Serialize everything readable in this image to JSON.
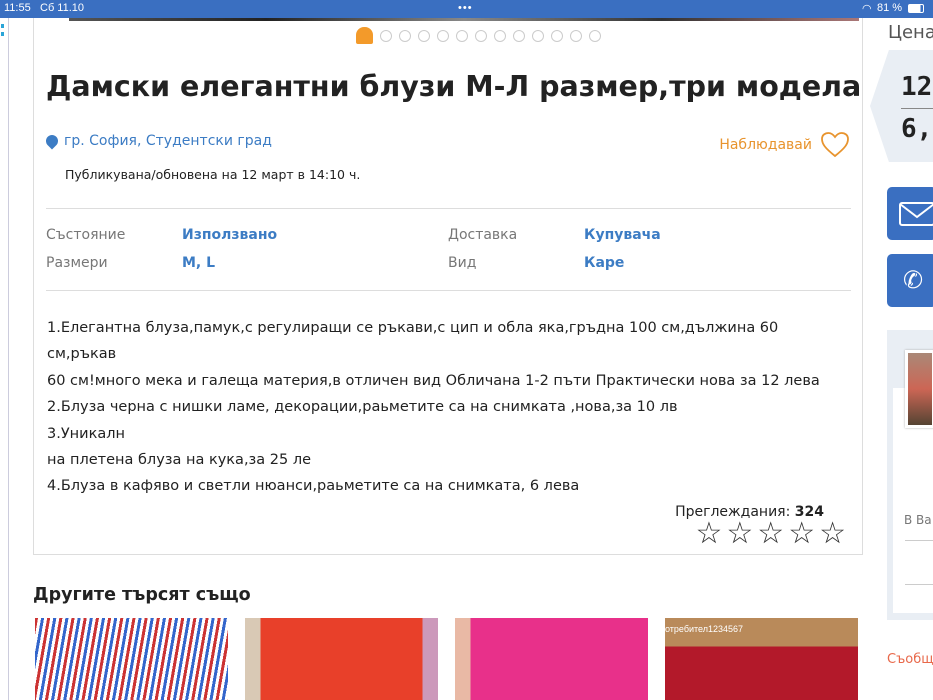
{
  "status": {
    "time": "11:55",
    "date": "Сб 11.10",
    "battery": "81 %"
  },
  "title": "Дамски елегантни блузи М-Л размер,три модела",
  "location": "гр. София, Студентски град",
  "watch_label": "Наблюдавай",
  "published": "Публикувана/обновена на 12 март в 14:10 ч.",
  "details": [
    {
      "label": "Състояние",
      "value": "Използвано"
    },
    {
      "label": "Доставка",
      "value": "Купувача"
    },
    {
      "label": "Размери",
      "value": "M, L"
    },
    {
      "label": "Вид",
      "value": "Каре"
    }
  ],
  "description": [
    "1.Елегантна блуза,памук,с регулиращи се ръкави,с цип и обла яка,гръдна 100 см,дължина 60 см,ръкав",
    "60 см!много мека и галеща материя,в отличен вид Обличана 1-2 пъти Практически нова за 12 лева",
    "2.Блуза черна с нишки ламе, декорации,раьметите са на снимката ,нова,за 10 лв",
    "3.Уникалн",
    "на плетена блуза на кука,за 25 ле",
    "4.Блуза в кафяво и светли нюанси,раьметите са на снимката, 6 лева"
  ],
  "views_label": "Преглеждания:",
  "views": "324",
  "rating": {
    "stars": 5,
    "filled": 0
  },
  "other_title": "Другите търсят също",
  "thumb_watermark": "отребител1234567",
  "sidebar": {
    "price_label": "Цена",
    "price1": "12",
    "price2": "6,",
    "location_partial": "В Ва",
    "message_partial": "Съобщ"
  },
  "colors": {
    "accent": "#3a6fc1",
    "orange": "#e8942e",
    "link": "#3c7cc4"
  }
}
